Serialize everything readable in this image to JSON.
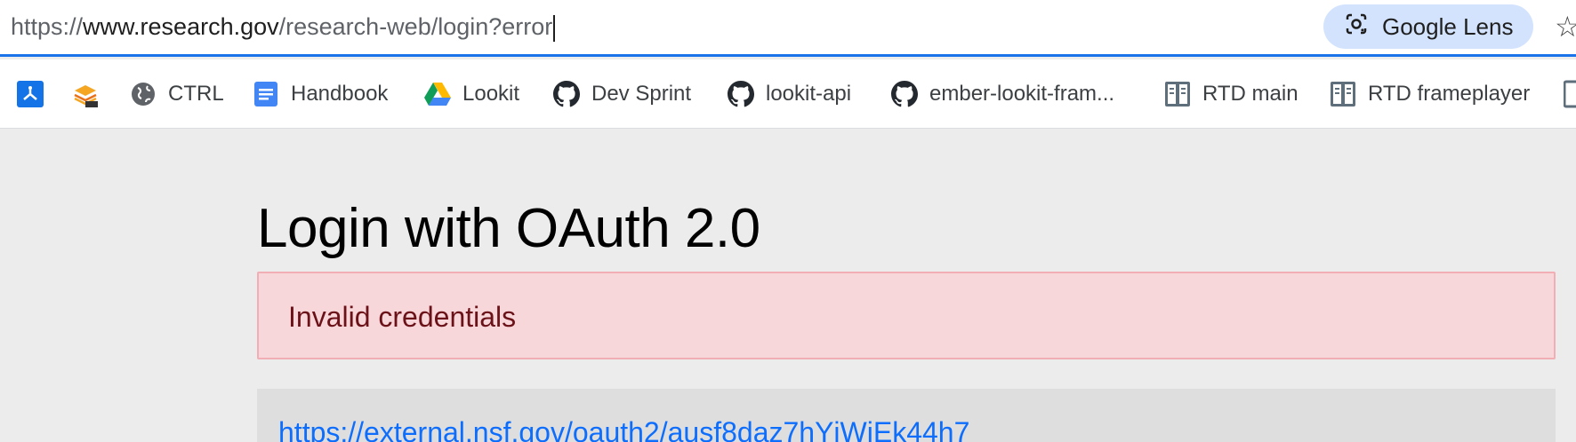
{
  "address_bar": {
    "url_prefix": "https://",
    "url_host": "www.research.gov",
    "url_path": "/research-web/login?error",
    "lens_label": "Google Lens"
  },
  "bookmarks": [
    {
      "label": "",
      "icon": "app-icon"
    },
    {
      "label": "",
      "icon": "stack-beta-icon"
    },
    {
      "label": "CTRL",
      "icon": "globe-icon"
    },
    {
      "label": "Handbook",
      "icon": "docs-icon"
    },
    {
      "label": "Lookit",
      "icon": "drive-icon"
    },
    {
      "label": "Dev Sprint",
      "icon": "github-icon"
    },
    {
      "label": "lookit-api",
      "icon": "github-icon"
    },
    {
      "label": "ember-lookit-fram...",
      "icon": "github-icon"
    },
    {
      "label": "RTD main",
      "icon": "readthedocs-icon"
    },
    {
      "label": "RTD frameplayer",
      "icon": "readthedocs-icon"
    }
  ],
  "page": {
    "title": "Login with OAuth 2.0",
    "alert": "Invalid credentials",
    "link": "https://external.nsf.gov/oauth2/ausf8daz7hYjWiEk44h7"
  },
  "colors": {
    "accent": "#1a73e8",
    "alert_bg": "#f8d7da",
    "alert_text": "#6b1219",
    "link": "#0d6efd"
  }
}
